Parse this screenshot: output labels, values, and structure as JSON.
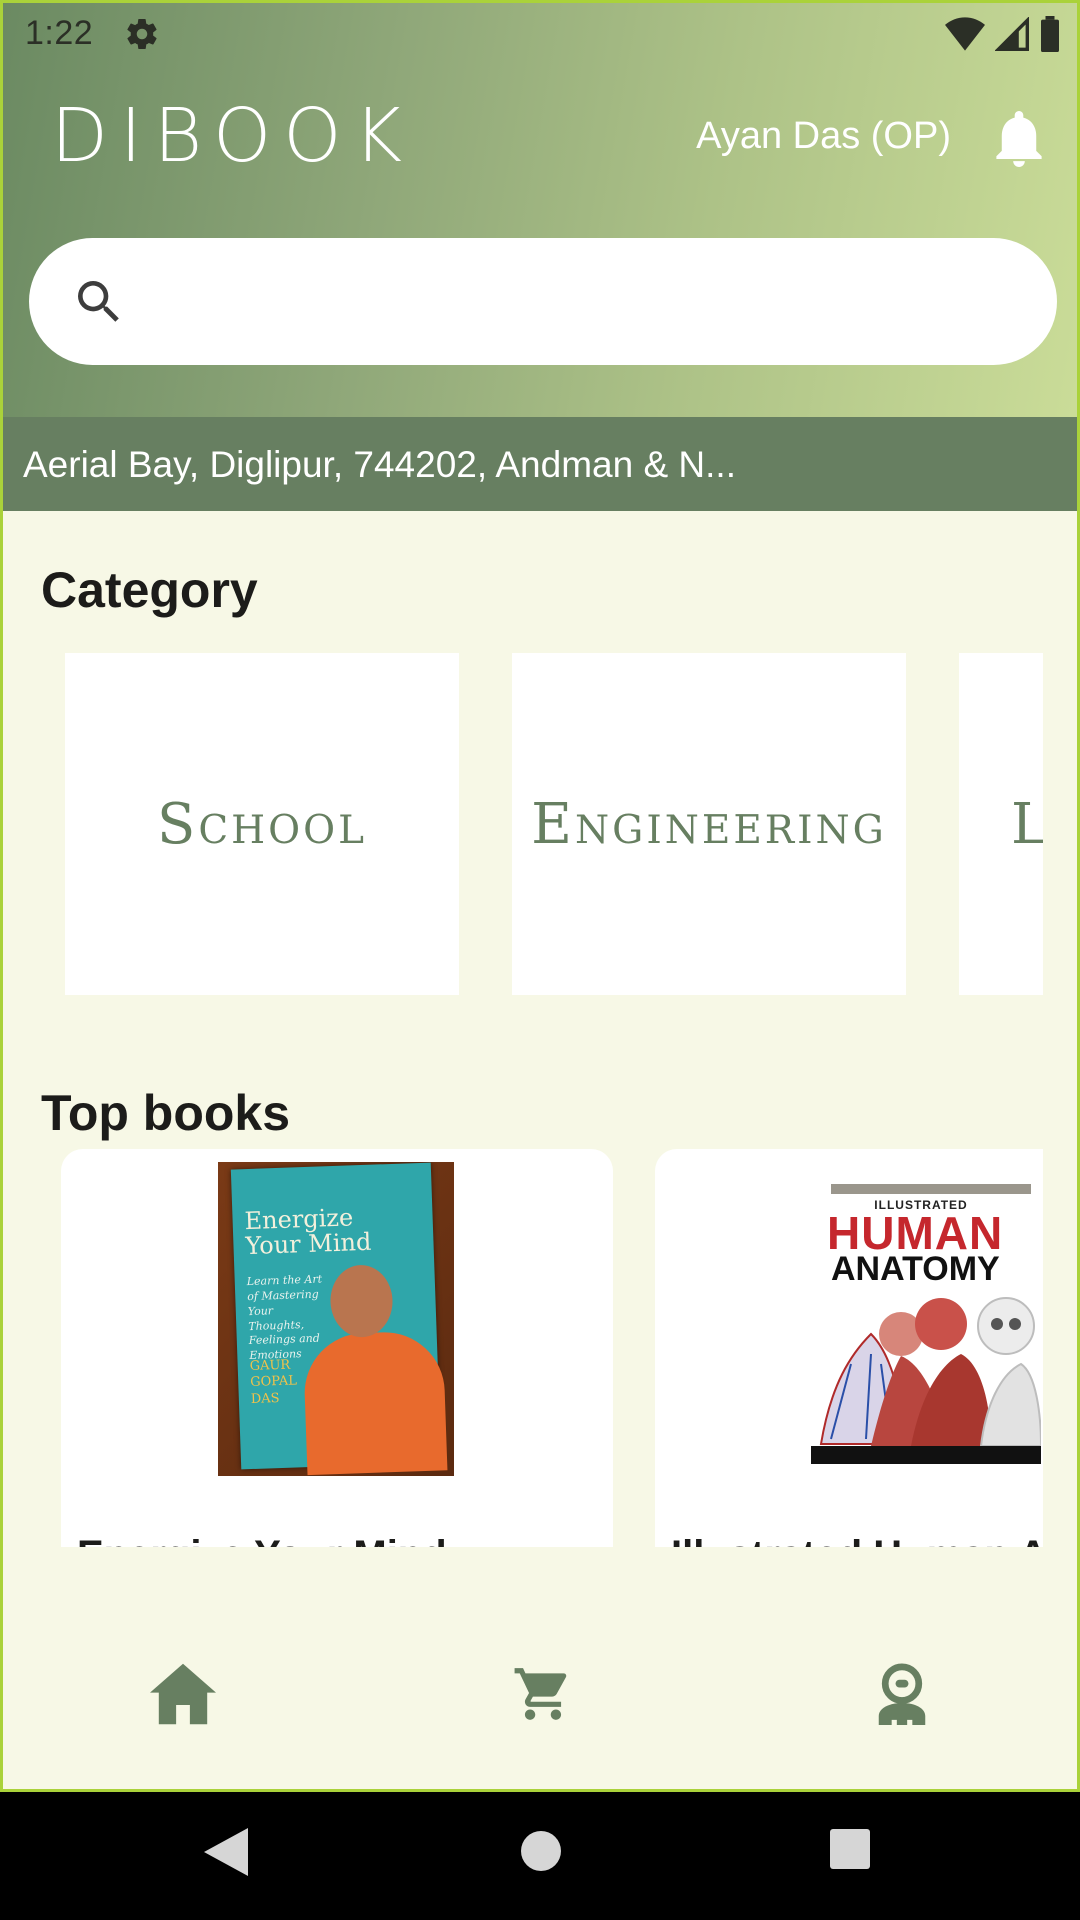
{
  "status_bar": {
    "time": "1:22",
    "icons": [
      "settings-gear-icon",
      "wifi-icon",
      "cell-signal-icon",
      "battery-icon"
    ]
  },
  "header": {
    "brand": "DIBOOK",
    "user_name": "Ayan Das (OP)",
    "bell_icon": "notification-bell-icon"
  },
  "search": {
    "placeholder": "",
    "value": "",
    "icon": "search-icon"
  },
  "address": {
    "text": "Aerial Bay, Diglipur, 744202, Andman & N..."
  },
  "category": {
    "title": "Category",
    "items": [
      {
        "label": "School"
      },
      {
        "label": "Engineering"
      },
      {
        "label": "L"
      }
    ]
  },
  "top_books": {
    "title": "Top books",
    "books": [
      {
        "title": "Energize Your Mind",
        "cover": {
          "line1": "Energize Your Mind",
          "line2": "Learn the Art of Mastering Your Thoughts, Feelings and Emotions",
          "author": "GAUR GOPAL DAS"
        }
      },
      {
        "title": "Illustrated Human A",
        "cover": {
          "line1": "ILLUSTRATED",
          "line2": "HUMAN",
          "line3": "ANATOMY"
        }
      }
    ]
  },
  "bottom_nav": {
    "items": [
      "home-icon",
      "cart-icon",
      "profile-icon"
    ]
  },
  "colors": {
    "accent": "#677f61",
    "background": "#f7f8e6",
    "card": "#ffffff"
  }
}
